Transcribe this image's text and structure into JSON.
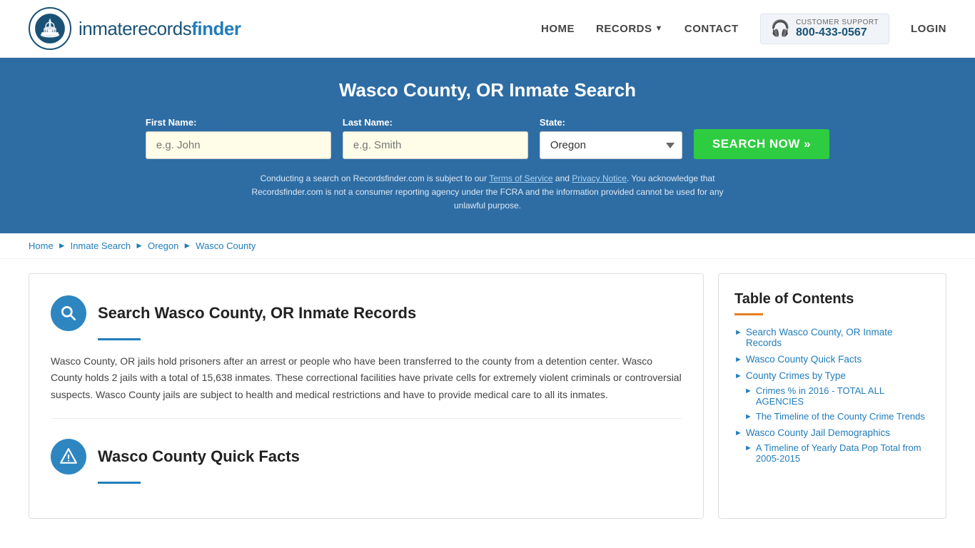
{
  "header": {
    "logo_text_light": "inmaterecords",
    "logo_text_bold": "finder",
    "nav": {
      "home": "HOME",
      "records": "RECORDS",
      "contact": "CONTACT",
      "login": "LOGIN"
    },
    "support": {
      "label": "CUSTOMER SUPPORT",
      "number": "800-433-0567"
    }
  },
  "hero": {
    "title": "Wasco County, OR Inmate Search",
    "form": {
      "first_name_label": "First Name:",
      "first_name_placeholder": "e.g. John",
      "last_name_label": "Last Name:",
      "last_name_placeholder": "e.g. Smith",
      "state_label": "State:",
      "state_value": "Oregon",
      "search_button": "SEARCH NOW »"
    },
    "disclaimer": "Conducting a search on Recordsfinder.com is subject to our Terms of Service and Privacy Notice. You acknowledge that Recordsfinder.com is not a consumer reporting agency under the FCRA and the information provided cannot be used for any unlawful purpose."
  },
  "breadcrumb": {
    "home": "Home",
    "inmate_search": "Inmate Search",
    "state": "Oregon",
    "county": "Wasco County"
  },
  "content": {
    "section1": {
      "title": "Search Wasco County, OR Inmate Records",
      "body": "Wasco County, OR jails hold prisoners after an arrest or people who have been transferred to the county from a detention center. Wasco County holds 2 jails with a total of 15,638 inmates. These correctional facilities have private cells for extremely violent criminals or controversial suspects. Wasco County jails are subject to health and medical restrictions and have to provide medical care to all its inmates."
    },
    "section2": {
      "title": "Wasco County Quick Facts"
    }
  },
  "sidebar": {
    "toc_title": "Table of Contents",
    "items": [
      {
        "label": "Search Wasco County, OR Inmate Records",
        "sub": []
      },
      {
        "label": "Wasco County Quick Facts",
        "sub": []
      },
      {
        "label": "County Crimes by Type",
        "sub": []
      },
      {
        "label": "Crimes % in 2016 - TOTAL ALL AGENCIES",
        "sub": [],
        "indent": true
      },
      {
        "label": "The Timeline of the County Crime Trends",
        "sub": [],
        "indent": true
      },
      {
        "label": "Wasco County Jail Demographics",
        "sub": []
      },
      {
        "label": "A Timeline of Yearly Data Pop Total from 2005-2015",
        "sub": [],
        "indent": true
      }
    ]
  }
}
